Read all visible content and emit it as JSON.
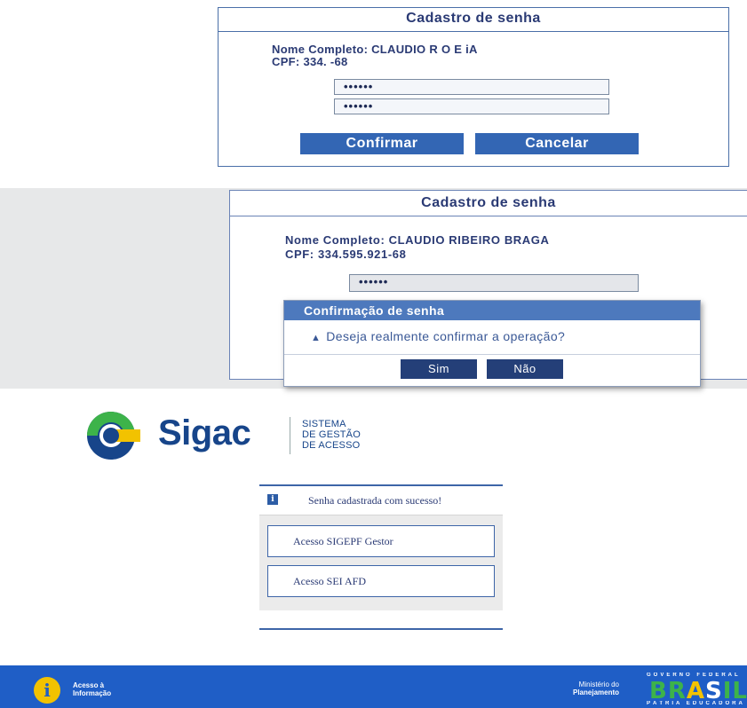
{
  "panel1": {
    "title": "Cadastro de senha",
    "nome_line": "Nome Completo:  CLAUDIO R            O E          iA",
    "cpf_line": "CPF:  334.              -68",
    "password1": "••••••",
    "password2": "••••••",
    "confirm_label": "Confirmar",
    "cancel_label": "Cancelar"
  },
  "panel2": {
    "title": "Cadastro de senha",
    "nome_line": "Nome Completo:  CLAUDIO RIBEIRO BRAGA",
    "cpf_line": "CPF:  334.595.921-68",
    "password1": "••••••",
    "dialog": {
      "title": "Confirmação de senha",
      "message": "Deseja realmente confirmar a operação?",
      "yes_label": "Sim",
      "no_label": "Não"
    }
  },
  "sigac": {
    "logo_name": "Sigac",
    "subtitle_line1": "SISTEMA",
    "subtitle_line2": "DE GESTÃO",
    "subtitle_line3": "DE ACESSO",
    "success_message": "Senha cadastrada com sucesso!",
    "links": [
      "Acesso SIGEPF Gestor",
      "Acesso SEI AFD"
    ]
  },
  "footer": {
    "acesso_line1": "Acesso à",
    "acesso_line2": "Informação",
    "ministerio_line1": "Ministério do",
    "ministerio_line2": "Planejamento",
    "gov_line": "GOVERNO FEDERAL",
    "brasil": "BRASIL",
    "patria_line": "PÁTRIA EDUCADORA"
  },
  "colors": {
    "brand_blue": "#17458a",
    "button_blue": "#3366b4",
    "dialog_title": "#4d79bd",
    "footer_blue": "#1f5ec6",
    "logo_green": "#3db34a",
    "logo_yellow": "#f2c200"
  },
  "icons": [
    "warning-icon",
    "info-icon",
    "sigac-logo-icon",
    "acesso-informacao-icon"
  ]
}
